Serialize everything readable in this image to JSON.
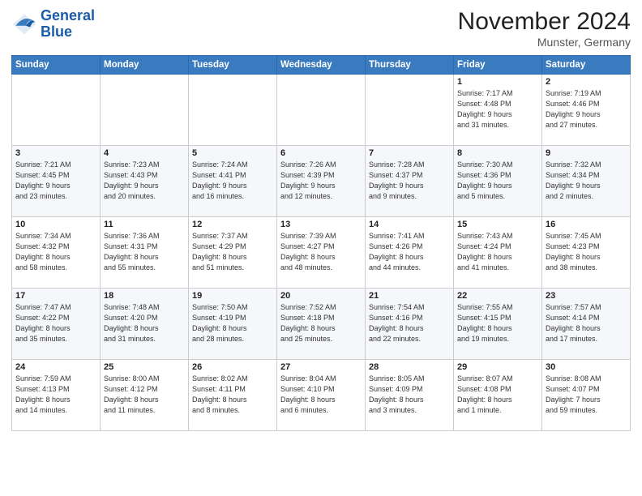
{
  "header": {
    "logo_line1": "General",
    "logo_line2": "Blue",
    "month_title": "November 2024",
    "location": "Munster, Germany"
  },
  "weekdays": [
    "Sunday",
    "Monday",
    "Tuesday",
    "Wednesday",
    "Thursday",
    "Friday",
    "Saturday"
  ],
  "weeks": [
    [
      {
        "day": "",
        "info": ""
      },
      {
        "day": "",
        "info": ""
      },
      {
        "day": "",
        "info": ""
      },
      {
        "day": "",
        "info": ""
      },
      {
        "day": "",
        "info": ""
      },
      {
        "day": "1",
        "info": "Sunrise: 7:17 AM\nSunset: 4:48 PM\nDaylight: 9 hours\nand 31 minutes."
      },
      {
        "day": "2",
        "info": "Sunrise: 7:19 AM\nSunset: 4:46 PM\nDaylight: 9 hours\nand 27 minutes."
      }
    ],
    [
      {
        "day": "3",
        "info": "Sunrise: 7:21 AM\nSunset: 4:45 PM\nDaylight: 9 hours\nand 23 minutes."
      },
      {
        "day": "4",
        "info": "Sunrise: 7:23 AM\nSunset: 4:43 PM\nDaylight: 9 hours\nand 20 minutes."
      },
      {
        "day": "5",
        "info": "Sunrise: 7:24 AM\nSunset: 4:41 PM\nDaylight: 9 hours\nand 16 minutes."
      },
      {
        "day": "6",
        "info": "Sunrise: 7:26 AM\nSunset: 4:39 PM\nDaylight: 9 hours\nand 12 minutes."
      },
      {
        "day": "7",
        "info": "Sunrise: 7:28 AM\nSunset: 4:37 PM\nDaylight: 9 hours\nand 9 minutes."
      },
      {
        "day": "8",
        "info": "Sunrise: 7:30 AM\nSunset: 4:36 PM\nDaylight: 9 hours\nand 5 minutes."
      },
      {
        "day": "9",
        "info": "Sunrise: 7:32 AM\nSunset: 4:34 PM\nDaylight: 9 hours\nand 2 minutes."
      }
    ],
    [
      {
        "day": "10",
        "info": "Sunrise: 7:34 AM\nSunset: 4:32 PM\nDaylight: 8 hours\nand 58 minutes."
      },
      {
        "day": "11",
        "info": "Sunrise: 7:36 AM\nSunset: 4:31 PM\nDaylight: 8 hours\nand 55 minutes."
      },
      {
        "day": "12",
        "info": "Sunrise: 7:37 AM\nSunset: 4:29 PM\nDaylight: 8 hours\nand 51 minutes."
      },
      {
        "day": "13",
        "info": "Sunrise: 7:39 AM\nSunset: 4:27 PM\nDaylight: 8 hours\nand 48 minutes."
      },
      {
        "day": "14",
        "info": "Sunrise: 7:41 AM\nSunset: 4:26 PM\nDaylight: 8 hours\nand 44 minutes."
      },
      {
        "day": "15",
        "info": "Sunrise: 7:43 AM\nSunset: 4:24 PM\nDaylight: 8 hours\nand 41 minutes."
      },
      {
        "day": "16",
        "info": "Sunrise: 7:45 AM\nSunset: 4:23 PM\nDaylight: 8 hours\nand 38 minutes."
      }
    ],
    [
      {
        "day": "17",
        "info": "Sunrise: 7:47 AM\nSunset: 4:22 PM\nDaylight: 8 hours\nand 35 minutes."
      },
      {
        "day": "18",
        "info": "Sunrise: 7:48 AM\nSunset: 4:20 PM\nDaylight: 8 hours\nand 31 minutes."
      },
      {
        "day": "19",
        "info": "Sunrise: 7:50 AM\nSunset: 4:19 PM\nDaylight: 8 hours\nand 28 minutes."
      },
      {
        "day": "20",
        "info": "Sunrise: 7:52 AM\nSunset: 4:18 PM\nDaylight: 8 hours\nand 25 minutes."
      },
      {
        "day": "21",
        "info": "Sunrise: 7:54 AM\nSunset: 4:16 PM\nDaylight: 8 hours\nand 22 minutes."
      },
      {
        "day": "22",
        "info": "Sunrise: 7:55 AM\nSunset: 4:15 PM\nDaylight: 8 hours\nand 19 minutes."
      },
      {
        "day": "23",
        "info": "Sunrise: 7:57 AM\nSunset: 4:14 PM\nDaylight: 8 hours\nand 17 minutes."
      }
    ],
    [
      {
        "day": "24",
        "info": "Sunrise: 7:59 AM\nSunset: 4:13 PM\nDaylight: 8 hours\nand 14 minutes."
      },
      {
        "day": "25",
        "info": "Sunrise: 8:00 AM\nSunset: 4:12 PM\nDaylight: 8 hours\nand 11 minutes."
      },
      {
        "day": "26",
        "info": "Sunrise: 8:02 AM\nSunset: 4:11 PM\nDaylight: 8 hours\nand 8 minutes."
      },
      {
        "day": "27",
        "info": "Sunrise: 8:04 AM\nSunset: 4:10 PM\nDaylight: 8 hours\nand 6 minutes."
      },
      {
        "day": "28",
        "info": "Sunrise: 8:05 AM\nSunset: 4:09 PM\nDaylight: 8 hours\nand 3 minutes."
      },
      {
        "day": "29",
        "info": "Sunrise: 8:07 AM\nSunset: 4:08 PM\nDaylight: 8 hours\nand 1 minute."
      },
      {
        "day": "30",
        "info": "Sunrise: 8:08 AM\nSunset: 4:07 PM\nDaylight: 7 hours\nand 59 minutes."
      }
    ]
  ]
}
